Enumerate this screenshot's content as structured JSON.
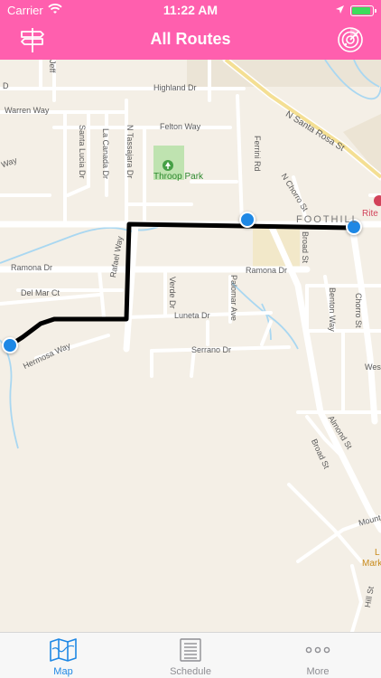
{
  "status_bar": {
    "carrier": "Carrier",
    "time": "11:22 AM"
  },
  "nav": {
    "title": "All Routes",
    "left_icon": "signpost-icon",
    "right_icon": "radar-icon"
  },
  "map": {
    "streets": {
      "highland": "Highland Dr",
      "warren": "Warren Way",
      "felton": "Felton Way",
      "santa_rosa": "N Santa Rosa St",
      "santa_lucia": "Santa Lucia Dr",
      "la_canada": "La Canada Dr",
      "tassajara": "N Tassajara Dr",
      "ferrini": "Ferrini Rd",
      "chorro_n": "N Chorro St",
      "foothill": "FOOTHILL",
      "ramona_w": "Ramona Dr",
      "ramona_e": "Ramona Dr",
      "del_mar": "Del Mar Ct",
      "rafael": "Rafael Way",
      "verde": "Verde Dr",
      "palomar": "Palomar Ave",
      "broad": "Broad St",
      "benton": "Benton Way",
      "chorro": "Chorro St",
      "luneta": "Luneta Dr",
      "hermosa": "Hermosa Way",
      "serrano": "Serrano Dr",
      "almond": "Almond St",
      "broad_s": "Broad St",
      "hill": "Hill St",
      "west": "Wes",
      "mounta": "Mounta",
      "jeff": "Jeff",
      "d": "D",
      "way_l": "Way"
    },
    "park": "Throop Park",
    "poi": "Rite",
    "market": [
      "L",
      "Mark"
    ]
  },
  "tabs": [
    {
      "label": "Map",
      "icon": "map-icon",
      "active": true
    },
    {
      "label": "Schedule",
      "icon": "schedule-icon",
      "active": false
    },
    {
      "label": "More",
      "icon": "more-icon",
      "active": false
    }
  ],
  "colors": {
    "accent": "#ff5fae",
    "route": "#000000",
    "stop": "#1e88e5",
    "active_tab": "#1e88e5"
  }
}
